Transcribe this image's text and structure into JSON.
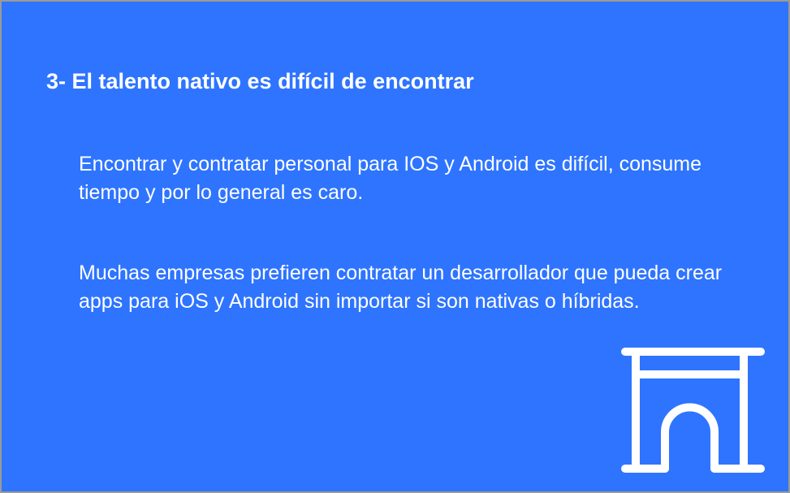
{
  "slide": {
    "title": "3- El talento nativo es difícil de encontrar",
    "paragraphs": [
      "Encontrar y contratar personal para IOS y Android es difícil, consume tiempo y por lo general es caro.",
      "Muchas empresas prefieren contratar un desarrollador que pueda crear apps para iOS y Android sin importar si son nativas o híbridas."
    ],
    "icon": "arch-icon",
    "colors": {
      "background": "#2e74ff",
      "text": "#ffffff"
    }
  }
}
